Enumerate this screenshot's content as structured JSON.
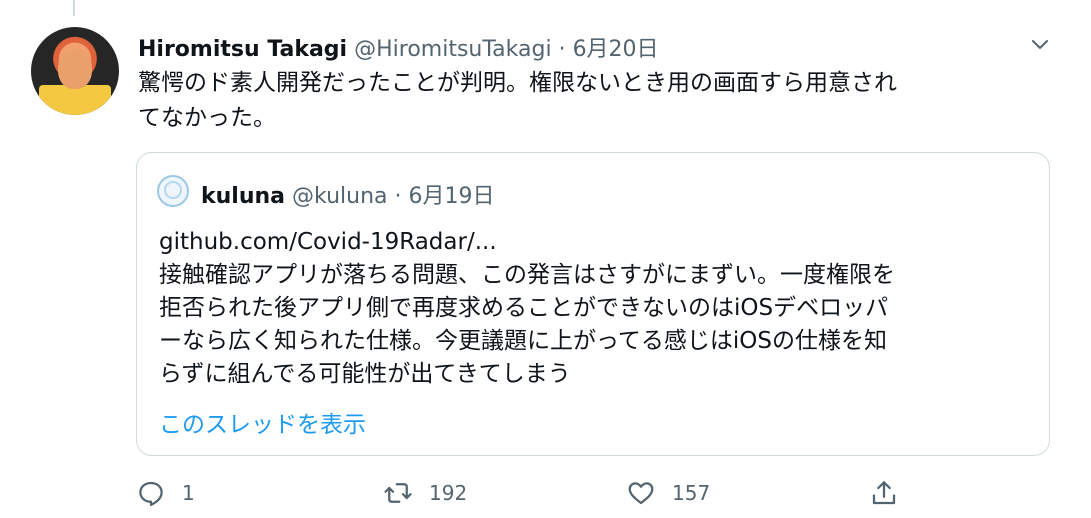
{
  "tweet": {
    "author_name": "Hiromitsu Takagi",
    "handle": "@HiromitsuTakagi",
    "separator": " · ",
    "date": "6月20日",
    "text": "驚愕のド素人開発だったことが判明。権限ないとき用の画面すら用意され\nてなかった。"
  },
  "quoted_tweet": {
    "author_name": "kuluna",
    "handle": "@kuluna",
    "separator": " · ",
    "date": "6月19日",
    "text": "github.com/Covid-19Radar/...\n接触確認アプリが落ちる問題、この発言はさすがにまずい。一度権限を\n拒否られた後アプリ側で再度求めることができないのはiOSデベロッパ\nーなら広く知られた仕様。今更議題に上がってる感じはiOSの仕様を知\nらずに組んでる可能性が出てきてしまう",
    "show_thread_label": "このスレッドを表示"
  },
  "actions": {
    "reply_icon": "reply-icon",
    "reply_count": "1",
    "retweet_icon": "retweet-icon",
    "retweet_count": "192",
    "like_icon": "heart-icon",
    "like_count": "157",
    "share_icon": "share-icon"
  },
  "colors": {
    "text": "#0f1419",
    "secondary": "#536471",
    "link": "#1d9bf0",
    "border": "#cfd9de"
  }
}
